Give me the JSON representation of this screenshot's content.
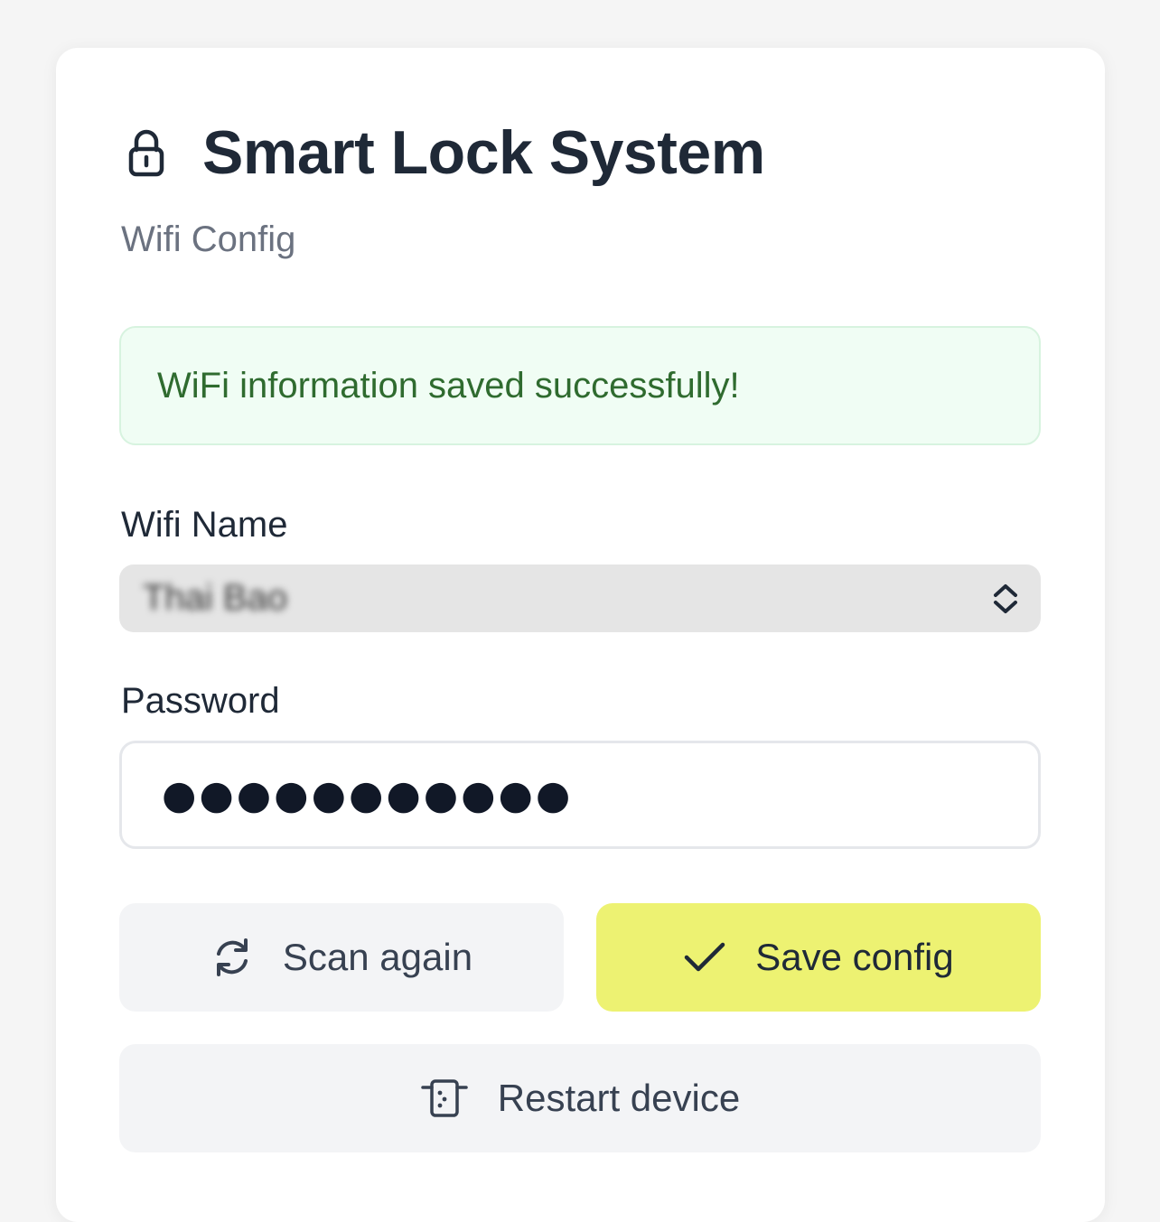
{
  "header": {
    "title": "Smart Lock System",
    "subtitle": "Wifi Config",
    "icon": "lock-icon"
  },
  "alert": {
    "message": "WiFi information saved successfully!",
    "status": "success",
    "background": "#f0fdf4",
    "text_color": "#2f6b2f"
  },
  "form": {
    "wifi_name": {
      "label": "Wifi Name",
      "value": "Thai Bao",
      "icon": "chevron-up-down-icon"
    },
    "password": {
      "label": "Password",
      "value": "●●●●●●●●●●●"
    }
  },
  "actions": {
    "scan": {
      "label": "Scan again",
      "icon": "refresh-icon"
    },
    "save": {
      "label": "Save config",
      "icon": "check-icon",
      "color": "#edf272"
    },
    "restart": {
      "label": "Restart device",
      "icon": "device-restart-icon"
    }
  }
}
